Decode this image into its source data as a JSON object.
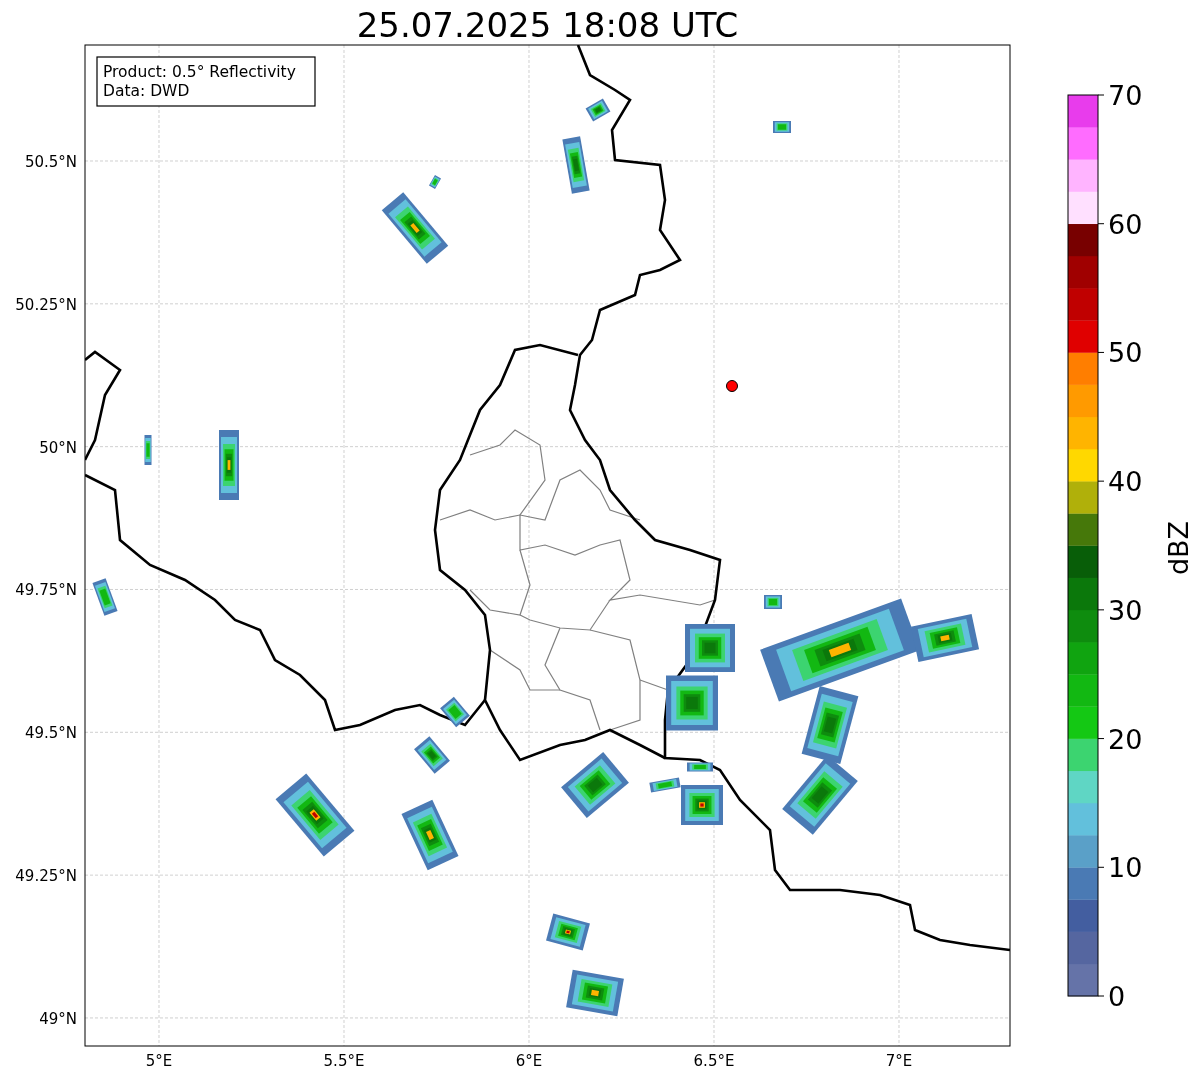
{
  "title": "25.07.2025 18:08 UTC",
  "info_box": {
    "lines": [
      "Product: 0.5° Reflectivity",
      "Data: DWD"
    ]
  },
  "map": {
    "lat_ticks": [
      "50.5°N",
      "50.25°N",
      "50°N",
      "49.75°N",
      "49.5°N",
      "49.25°N",
      "49°N"
    ],
    "lon_ticks": [
      "5°E",
      "5.5°E",
      "6°E",
      "6.5°E",
      "7°E"
    ]
  },
  "colorbar": {
    "label": "dBZ",
    "ticks": [
      "70",
      "60",
      "50",
      "40",
      "30",
      "20",
      "10",
      "0"
    ],
    "segments": [
      {
        "color": "#6573a8"
      },
      {
        "color": "#5566a0"
      },
      {
        "color": "#435ea0"
      },
      {
        "color": "#4a7ab4"
      },
      {
        "color": "#5aa0c8"
      },
      {
        "color": "#62c0dc"
      },
      {
        "color": "#5fd6c4"
      },
      {
        "color": "#3cd470"
      },
      {
        "color": "#14c814"
      },
      {
        "color": "#12b812"
      },
      {
        "color": "#10a410"
      },
      {
        "color": "#0e8c0e"
      },
      {
        "color": "#0b780b"
      },
      {
        "color": "#085e08"
      },
      {
        "color": "#46780a"
      },
      {
        "color": "#b0b00a"
      },
      {
        "color": "#ffd800"
      },
      {
        "color": "#ffb400"
      },
      {
        "color": "#ff9a00"
      },
      {
        "color": "#ff7e00"
      },
      {
        "color": "#e00000"
      },
      {
        "color": "#c00000"
      },
      {
        "color": "#a00000"
      },
      {
        "color": "#780000"
      },
      {
        "color": "#ffe0ff"
      },
      {
        "color": "#ffb4ff"
      },
      {
        "color": "#ff6cff"
      },
      {
        "color": "#e83cec"
      }
    ]
  }
}
